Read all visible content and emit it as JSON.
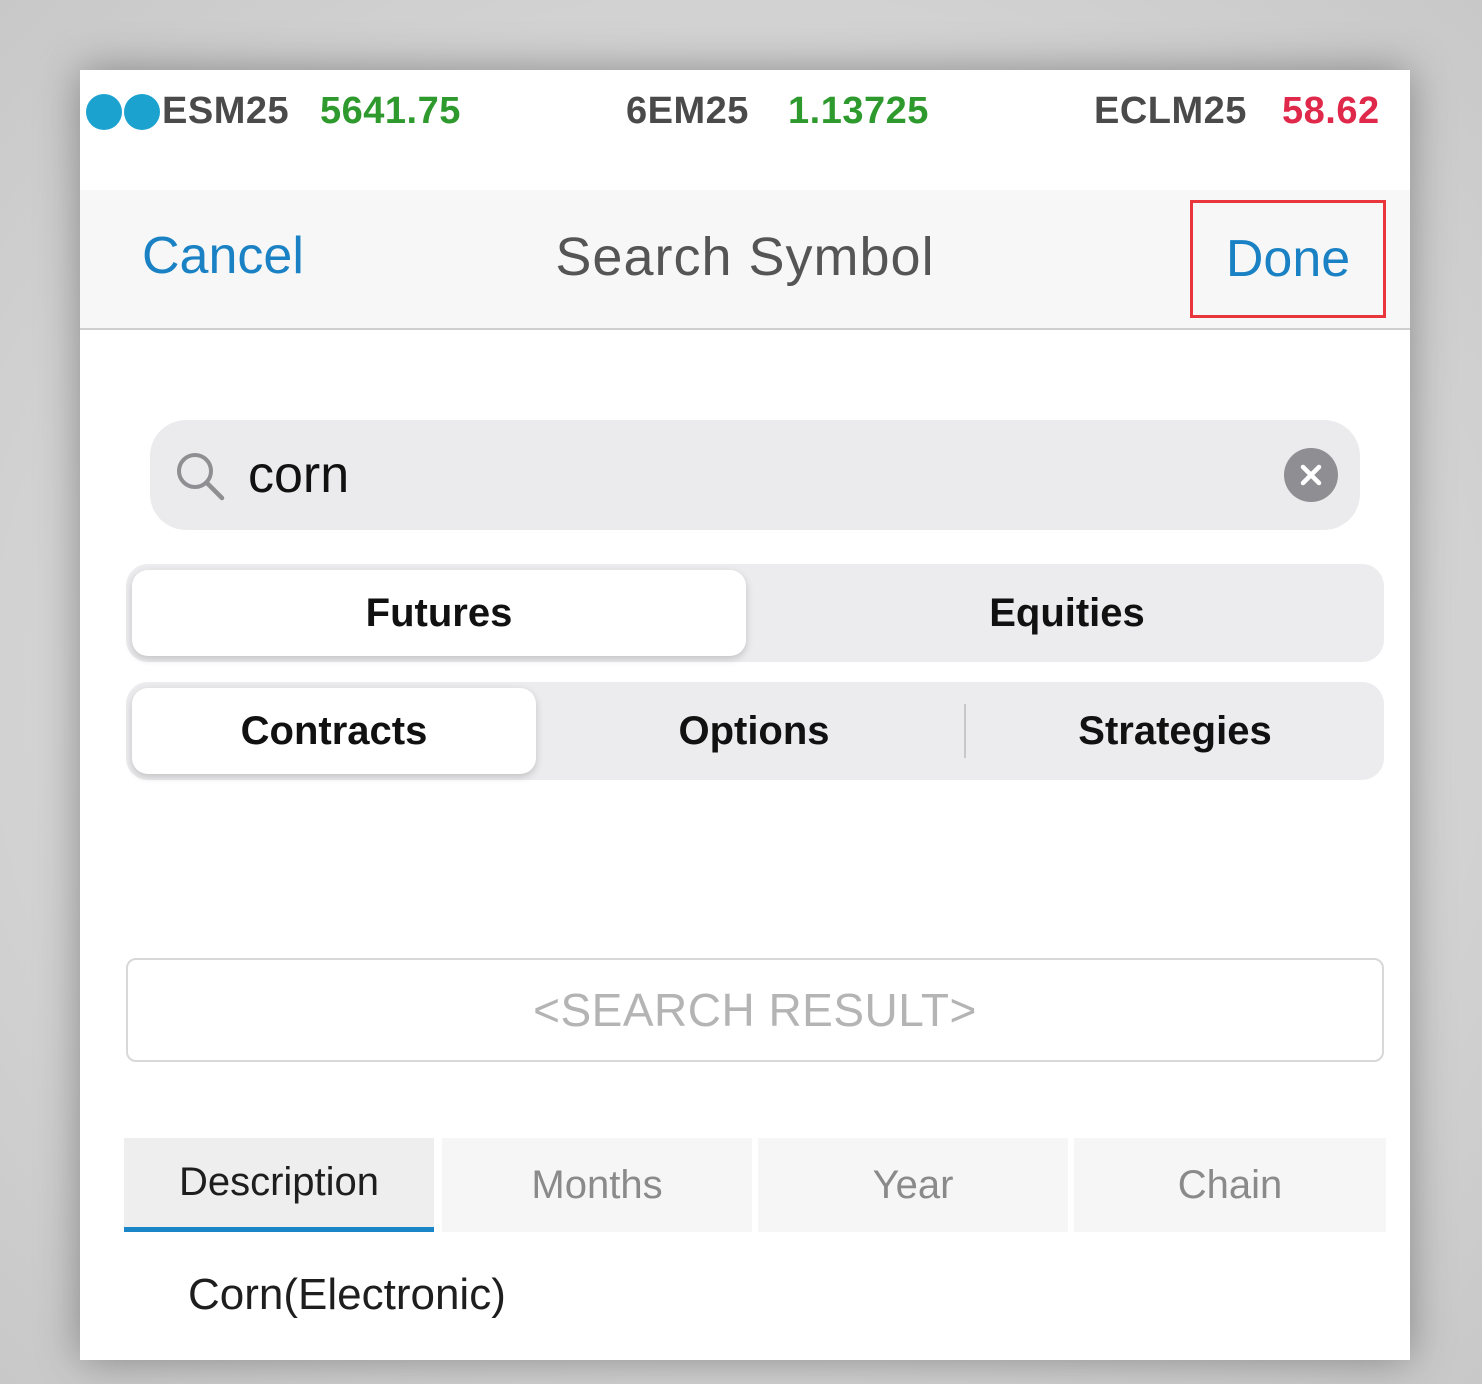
{
  "ticker": [
    {
      "symbol": "ESM25",
      "price": "5641.75",
      "direction": "up"
    },
    {
      "symbol": "6EM25",
      "price": "1.13725",
      "direction": "up"
    },
    {
      "symbol": "ECLM25",
      "price": "58.62",
      "direction": "down"
    }
  ],
  "navbar": {
    "cancel_label": "Cancel",
    "title": "Search Symbol",
    "done_label": "Done"
  },
  "search": {
    "value": "corn",
    "icon": "search-icon",
    "clear_icon": "close-icon"
  },
  "asset_class": {
    "options": [
      "Futures",
      "Equities"
    ],
    "selected": "Futures"
  },
  "instrument_type": {
    "options": [
      "Contracts",
      "Options",
      "Strategies"
    ],
    "selected": "Contracts"
  },
  "result_placeholder": "<SEARCH RESULT>",
  "columns": {
    "tabs": [
      "Description",
      "Months",
      "Year",
      "Chain"
    ],
    "selected": "Description"
  },
  "results": [
    {
      "description": "Corn(Electronic)"
    }
  ],
  "colors": {
    "accent": "#1a82c4",
    "up": "#2e9a2e",
    "down": "#e0284a",
    "highlight_box": "#e8363c"
  }
}
